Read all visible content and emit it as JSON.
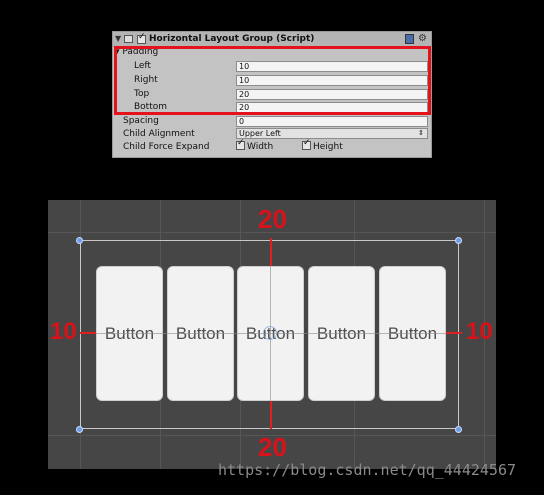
{
  "inspector": {
    "component_title": "Horizontal Layout Group (Script)",
    "enabled": true,
    "padding_label": "Padding",
    "padding": [
      {
        "label": "Left",
        "value": "10"
      },
      {
        "label": "Right",
        "value": "10"
      },
      {
        "label": "Top",
        "value": "20"
      },
      {
        "label": "Bottom",
        "value": "20"
      }
    ],
    "spacing": {
      "label": "Spacing",
      "value": "0"
    },
    "child_alignment": {
      "label": "Child Alignment",
      "value": "Upper Left"
    },
    "child_force_expand": {
      "label": "Child Force Expand",
      "width": {
        "label": "Width",
        "checked": true
      },
      "height": {
        "label": "Height",
        "checked": true
      }
    },
    "highlight_color": "#e3121b"
  },
  "scene": {
    "buttons": [
      "Button",
      "Button",
      "Button",
      "Button",
      "Button"
    ],
    "padding_annotations": {
      "top": "20",
      "bottom": "20",
      "left": "10",
      "right": "10"
    },
    "annotation_color": "#d8121a",
    "handle_color": "#6f9ee8"
  },
  "watermark": "https://blog.csdn.net/qq_44424567"
}
